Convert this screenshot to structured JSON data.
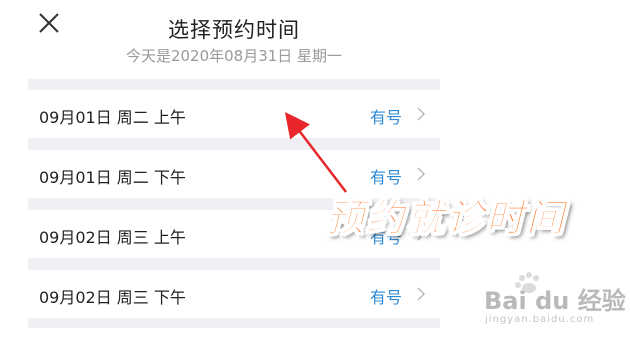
{
  "header": {
    "title": "选择预约时间",
    "subtitle": "今天是2020年08月31日 星期一",
    "close_icon": "close-icon"
  },
  "slots": [
    {
      "date": "09月01日 周二 上午",
      "status": "有号"
    },
    {
      "date": "09月01日 周二 下午",
      "status": "有号"
    },
    {
      "date": "09月02日 周三 上午",
      "status": "有号"
    },
    {
      "date": "09月02日 周三 下午",
      "status": "有号"
    }
  ],
  "annotation": {
    "text": "预约就诊时间",
    "color": "#ff6a13",
    "arrow_color": "#e8262b"
  },
  "watermark": {
    "text": "Bai du 经验",
    "sub": "jingyan.baidu.com"
  },
  "colors": {
    "status_link": "#2e8bd6",
    "panel_bg": "#efeff4"
  }
}
